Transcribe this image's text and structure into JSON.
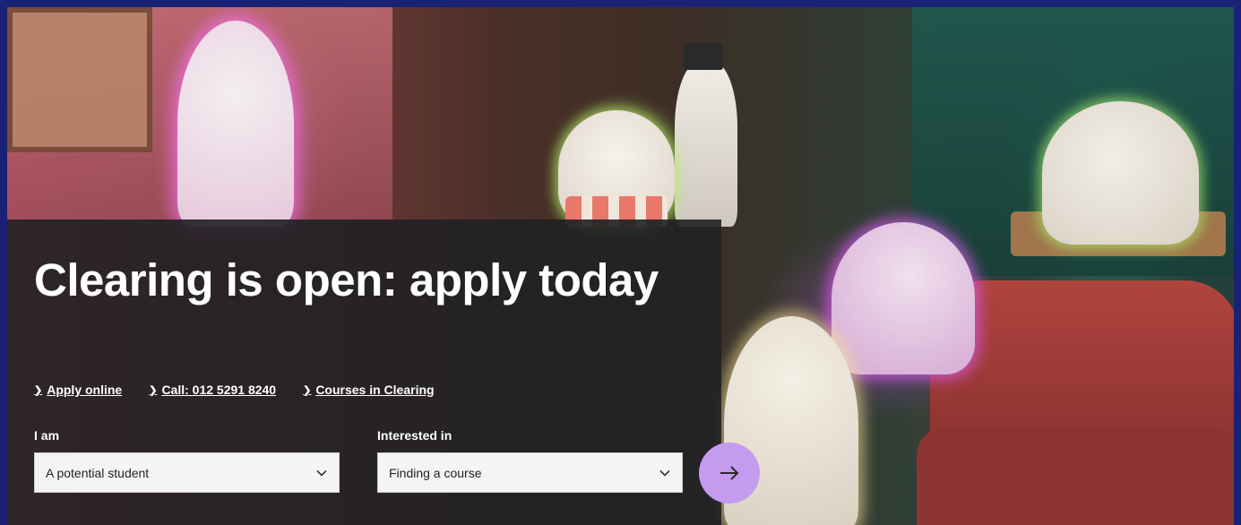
{
  "hero": {
    "headline": "Clearing is open: apply today",
    "links": [
      {
        "label": "Apply online"
      },
      {
        "label": "Call: 012 5291 8240"
      },
      {
        "label": "Courses in Clearing"
      }
    ],
    "form": {
      "i_am": {
        "label": "I am",
        "value": "A potential student"
      },
      "interested_in": {
        "label": "Interested in",
        "value": "Finding a course"
      },
      "submit_icon": "arrow-right-icon"
    }
  },
  "colors": {
    "frame_border": "#1a2275",
    "panel_bg": "#212124",
    "submit_button": "#c49bef",
    "text": "#ffffff"
  }
}
